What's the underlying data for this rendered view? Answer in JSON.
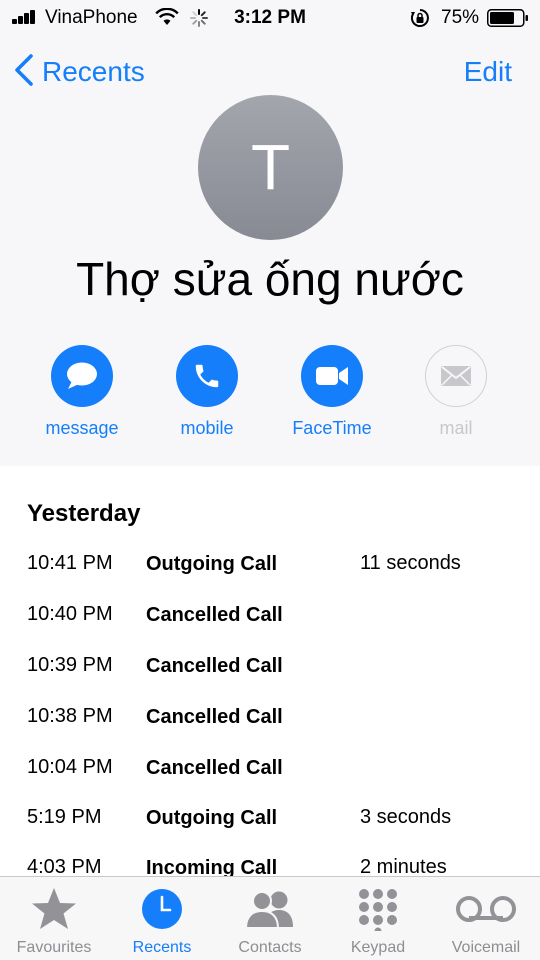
{
  "status_bar": {
    "carrier": "VinaPhone",
    "time": "3:12 PM",
    "battery_percent": "75%",
    "battery_level": 0.75
  },
  "nav": {
    "back_label": "Recents",
    "edit_label": "Edit"
  },
  "contact": {
    "initial": "T",
    "name": "Thợ sửa ống nước"
  },
  "actions": {
    "message": "message",
    "mobile": "mobile",
    "facetime": "FaceTime",
    "mail": "mail"
  },
  "history": {
    "section_title": "Yesterday",
    "calls": [
      {
        "time": "10:41 PM",
        "type": "Outgoing Call",
        "duration": "11 seconds"
      },
      {
        "time": "10:40 PM",
        "type": "Cancelled Call",
        "duration": ""
      },
      {
        "time": "10:39 PM",
        "type": "Cancelled Call",
        "duration": ""
      },
      {
        "time": "10:38 PM",
        "type": "Cancelled Call",
        "duration": ""
      },
      {
        "time": "10:04 PM",
        "type": "Cancelled Call",
        "duration": ""
      },
      {
        "time": "5:19 PM",
        "type": "Outgoing Call",
        "duration": "3 seconds"
      },
      {
        "time": "4:03 PM",
        "type": "Incoming Call",
        "duration": "2 minutes"
      }
    ]
  },
  "tabs": [
    {
      "label": "Favourites",
      "icon": "star-icon",
      "active": false
    },
    {
      "label": "Recents",
      "icon": "clock-icon",
      "active": true
    },
    {
      "label": "Contacts",
      "icon": "contacts-icon",
      "active": false
    },
    {
      "label": "Keypad",
      "icon": "keypad-icon",
      "active": false
    },
    {
      "label": "Voicemail",
      "icon": "voicemail-icon",
      "active": false
    }
  ],
  "colors": {
    "accent": "#157efb",
    "header_bg": "#f7f7f9",
    "tab_inactive": "#8e8e93",
    "disabled": "#c7c7cc"
  }
}
